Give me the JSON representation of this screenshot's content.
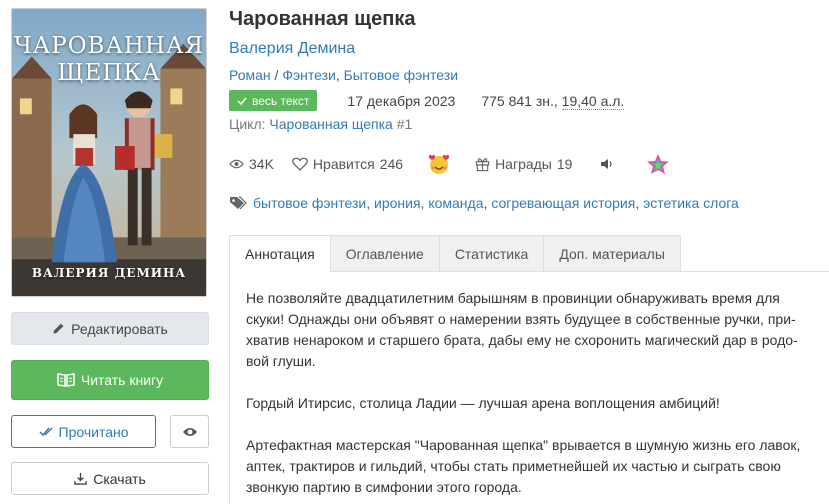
{
  "cover": {
    "title_line1": "ЧАРОВАННАЯ",
    "title_line2": "ЩЕПКА",
    "author": "ВАЛЕРИЯ ДЕМИНА"
  },
  "actions": {
    "edit": "Редактировать",
    "read": "Читать книгу",
    "done": "Прочитано",
    "download": "Скачать"
  },
  "book": {
    "title": "Чарованная щепка",
    "author": "Валерия Демина",
    "genre_form": "Роман",
    "genre_sep": " / ",
    "genres": [
      "Фэнтези",
      "Бытовое фэнтези"
    ],
    "badge": "весь текст",
    "date": "17 декабря 2023",
    "size_chars": "775 841 зн., ",
    "size_al": "19,40 а.л.",
    "cycle_label": "Цикл: ",
    "cycle_name": "Чарованная щепка",
    "cycle_num": " #1"
  },
  "stats": {
    "views": "34K",
    "likes_label": "Нравится",
    "likes": "246",
    "awards_label": "Награды",
    "awards": "19"
  },
  "tags": [
    "бытовое фэнтези",
    "ирония",
    "команда",
    "согревающая история",
    "эстетика слога"
  ],
  "tabs": [
    "Аннотация",
    "Оглавление",
    "Статистика",
    "Доп. материалы"
  ],
  "annotation": [
    "Не позволяйте двадцатилетним барышням в провинции обнаруживать время для скуки! Однажды они объявят о намерении взять будущее в собственные ручки, при­хватив ненароком и старшего брата, дабы ему не схоронить магический дар в родо­вой глуши.",
    "Гордый Итирсис, столица Ладии — лучшая арена воплощения амбиций!",
    "Артефактная мастерская \"Чарованная щепка\" врывается в шумную жизнь его лавок, аптек, трактиров и гильдий, чтобы стать приметнейшей их частью и сыграть свою звонкую партию в симфонии этого города."
  ],
  "colors": {
    "link": "#337ab7",
    "success": "#5cb85c"
  }
}
